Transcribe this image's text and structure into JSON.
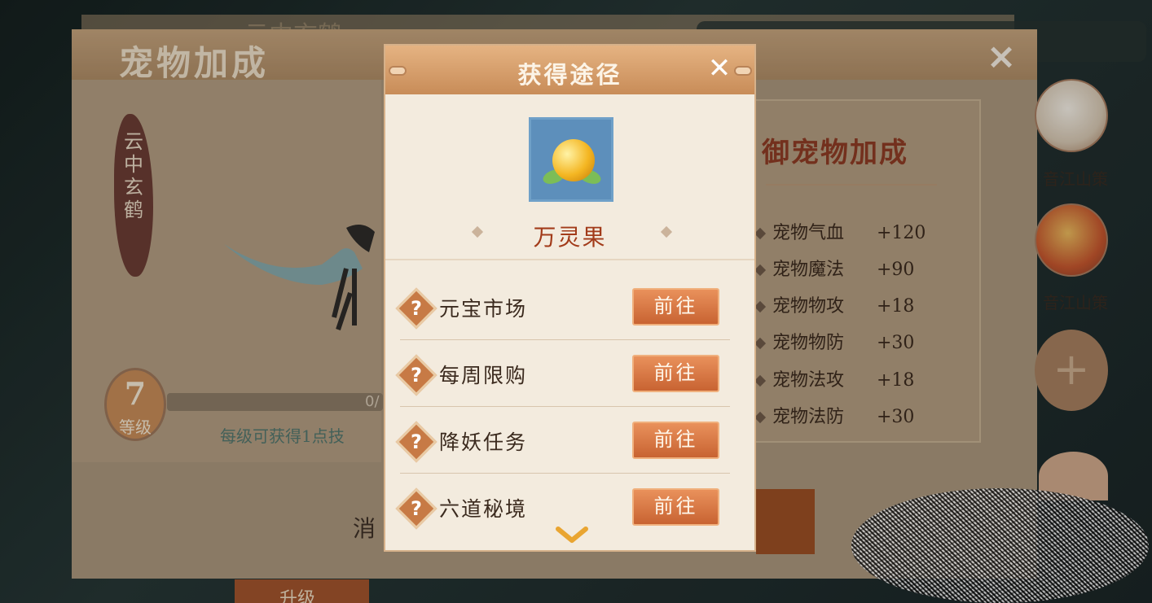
{
  "background": {
    "faded_title": "云中玄鹤"
  },
  "main_panel": {
    "title": "宠物加成",
    "close_icon": "×",
    "pet_name": "云中玄鹤",
    "level": "7",
    "level_label": "等级",
    "exp_text": "0/",
    "hint": "每级可获得1点技",
    "consume_label": "消",
    "upgrade_label": "升级"
  },
  "defense_panel": {
    "title": "御宠物加成",
    "stats": [
      {
        "name": "宠物气血",
        "value": "+120"
      },
      {
        "name": "宠物魔法",
        "value": "+90"
      },
      {
        "name": "宠物物攻",
        "value": "+18"
      },
      {
        "name": "宠物物防",
        "value": "+30"
      },
      {
        "name": "宠物法攻",
        "value": "+18"
      },
      {
        "name": "宠物法防",
        "value": "+30"
      }
    ]
  },
  "side_avatars": [
    {
      "label": "音江山策",
      "style": "white"
    },
    {
      "label": "音江山策",
      "style": "red"
    }
  ],
  "add_slot_icon": "+",
  "dialog": {
    "title": "获得途径",
    "close_icon": "✕",
    "item": {
      "name": "万灵果",
      "icon": "golden-fruit-icon"
    },
    "routes": [
      {
        "label": "元宝市场",
        "button": "前往"
      },
      {
        "label": "每周限购",
        "button": "前往"
      },
      {
        "label": "降妖任务",
        "button": "前往"
      },
      {
        "label": "六道秘境",
        "button": "前往"
      }
    ],
    "help_icon_glyph": "?"
  },
  "colors": {
    "accent_orange": "#c86332",
    "title_red": "#8d3b24",
    "item_name_red": "#a23b1a",
    "hint_green": "#52766d"
  }
}
